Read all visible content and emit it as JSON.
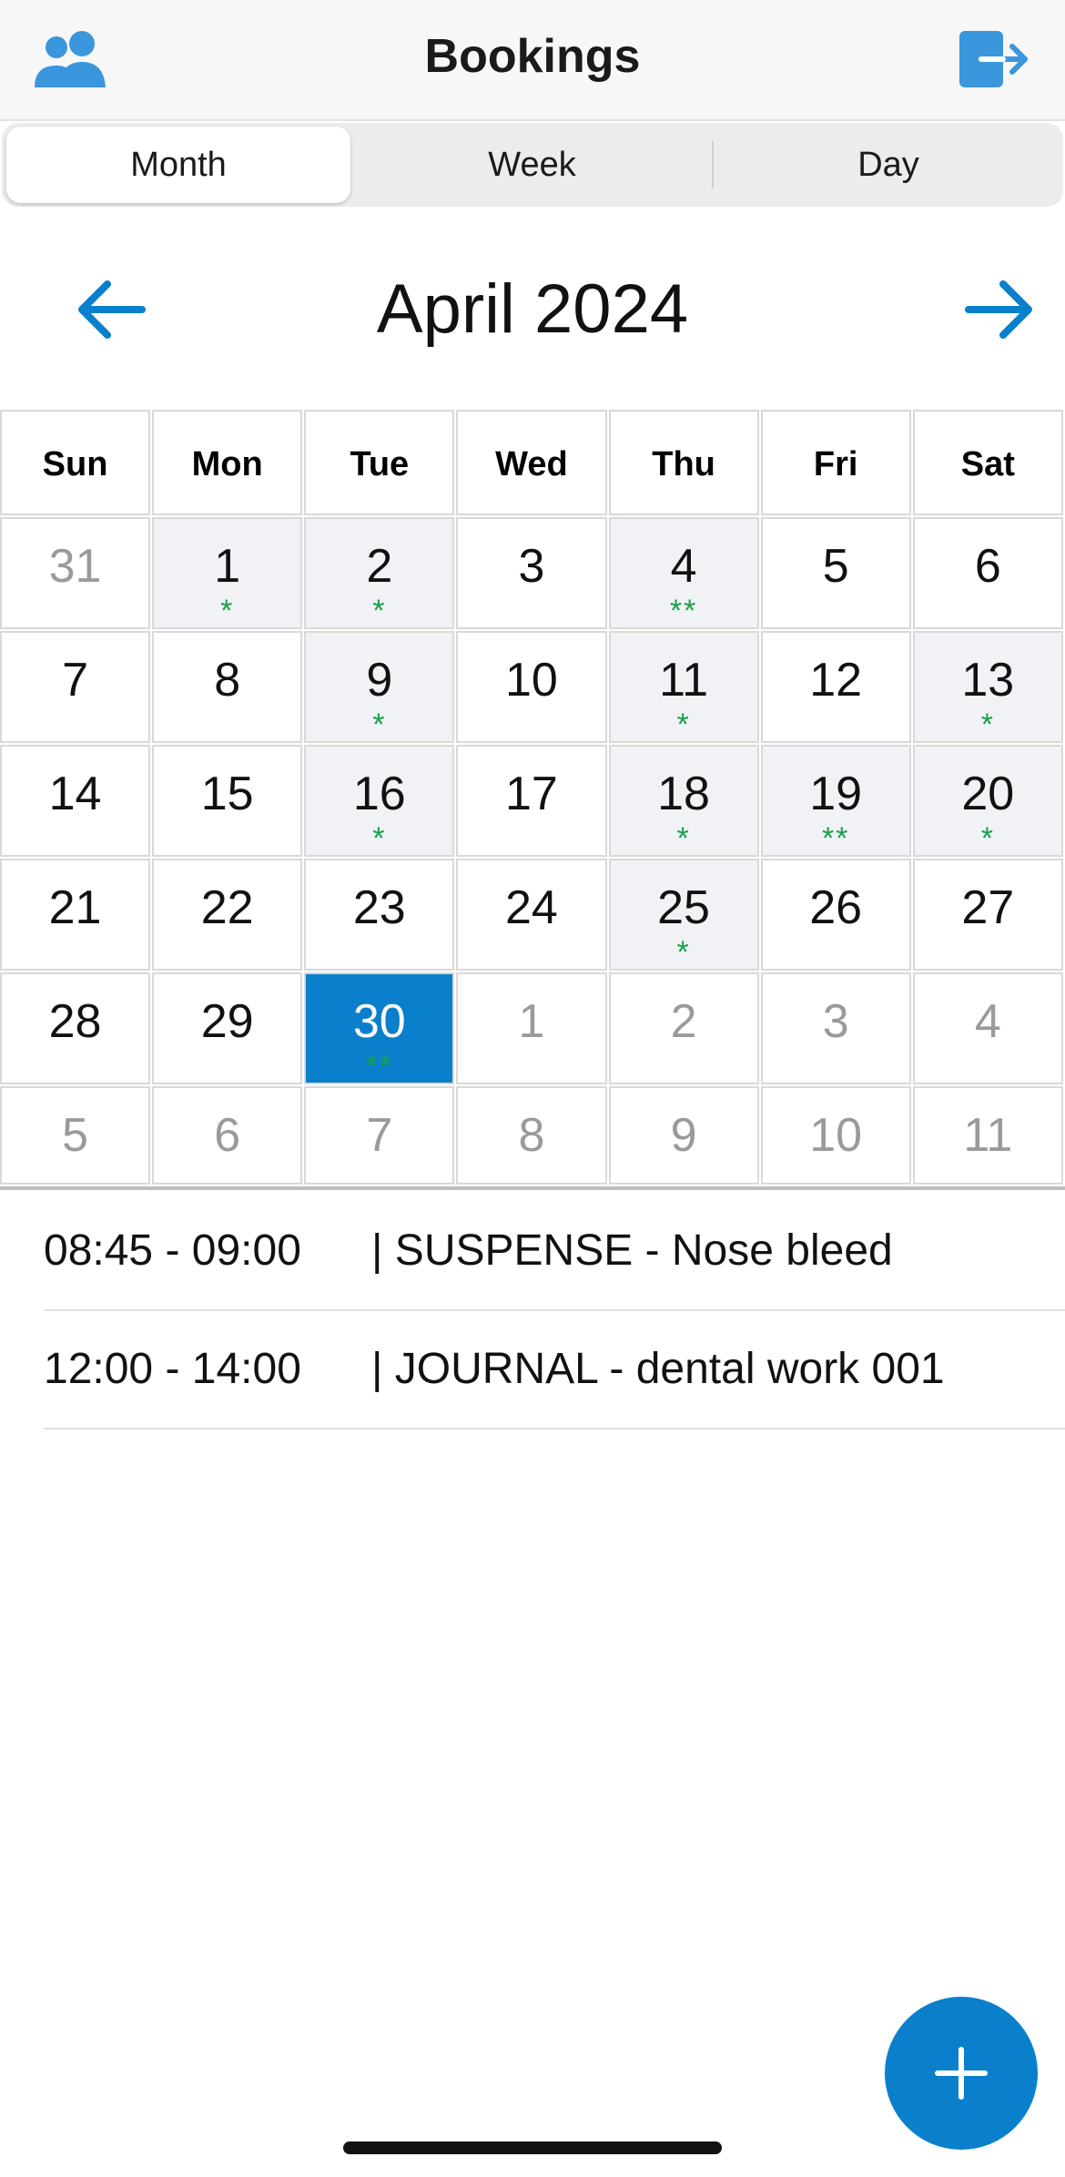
{
  "header": {
    "title": "Bookings",
    "left_icon": "users-icon",
    "right_icon": "logout-icon",
    "accent_color": "#3a96dd"
  },
  "view_tabs": [
    {
      "label": "Month",
      "selected": true
    },
    {
      "label": "Week",
      "selected": false
    },
    {
      "label": "Day",
      "selected": false
    }
  ],
  "calendar": {
    "month_title": "April 2024",
    "prev_icon": "arrow-left-icon",
    "next_icon": "arrow-right-icon",
    "weekdays": [
      "Sun",
      "Mon",
      "Tue",
      "Wed",
      "Thu",
      "Fri",
      "Sat"
    ],
    "weeks": [
      [
        {
          "day": "31",
          "current_month": false,
          "markers": ""
        },
        {
          "day": "1",
          "current_month": true,
          "markers": "*"
        },
        {
          "day": "2",
          "current_month": true,
          "markers": "*"
        },
        {
          "day": "3",
          "current_month": true,
          "markers": ""
        },
        {
          "day": "4",
          "current_month": true,
          "markers": "**"
        },
        {
          "day": "5",
          "current_month": true,
          "markers": ""
        },
        {
          "day": "6",
          "current_month": true,
          "markers": ""
        }
      ],
      [
        {
          "day": "7",
          "current_month": true,
          "markers": ""
        },
        {
          "day": "8",
          "current_month": true,
          "markers": ""
        },
        {
          "day": "9",
          "current_month": true,
          "markers": "*"
        },
        {
          "day": "10",
          "current_month": true,
          "markers": ""
        },
        {
          "day": "11",
          "current_month": true,
          "markers": "*"
        },
        {
          "day": "12",
          "current_month": true,
          "markers": ""
        },
        {
          "day": "13",
          "current_month": true,
          "markers": "*"
        }
      ],
      [
        {
          "day": "14",
          "current_month": true,
          "markers": ""
        },
        {
          "day": "15",
          "current_month": true,
          "markers": ""
        },
        {
          "day": "16",
          "current_month": true,
          "markers": "*"
        },
        {
          "day": "17",
          "current_month": true,
          "markers": ""
        },
        {
          "day": "18",
          "current_month": true,
          "markers": "*"
        },
        {
          "day": "19",
          "current_month": true,
          "markers": "**"
        },
        {
          "day": "20",
          "current_month": true,
          "markers": "*"
        }
      ],
      [
        {
          "day": "21",
          "current_month": true,
          "markers": ""
        },
        {
          "day": "22",
          "current_month": true,
          "markers": ""
        },
        {
          "day": "23",
          "current_month": true,
          "markers": ""
        },
        {
          "day": "24",
          "current_month": true,
          "markers": ""
        },
        {
          "day": "25",
          "current_month": true,
          "markers": "*"
        },
        {
          "day": "26",
          "current_month": true,
          "markers": ""
        },
        {
          "day": "27",
          "current_month": true,
          "markers": ""
        }
      ],
      [
        {
          "day": "28",
          "current_month": true,
          "markers": ""
        },
        {
          "day": "29",
          "current_month": true,
          "markers": ""
        },
        {
          "day": "30",
          "current_month": true,
          "markers": "**",
          "selected": true
        },
        {
          "day": "1",
          "current_month": false,
          "markers": ""
        },
        {
          "day": "2",
          "current_month": false,
          "markers": ""
        },
        {
          "day": "3",
          "current_month": false,
          "markers": ""
        },
        {
          "day": "4",
          "current_month": false,
          "markers": ""
        }
      ],
      [
        {
          "day": "5",
          "current_month": false,
          "markers": ""
        },
        {
          "day": "6",
          "current_month": false,
          "markers": ""
        },
        {
          "day": "7",
          "current_month": false,
          "markers": ""
        },
        {
          "day": "8",
          "current_month": false,
          "markers": ""
        },
        {
          "day": "9",
          "current_month": false,
          "markers": ""
        },
        {
          "day": "10",
          "current_month": false,
          "markers": ""
        },
        {
          "day": "11",
          "current_month": false,
          "markers": ""
        }
      ]
    ],
    "event_marker_color": "#1aa04c",
    "selected_color": "#0a80cc"
  },
  "events": [
    {
      "time": "08:45 - 09:00",
      "text": "| SUSPENSE - Nose bleed"
    },
    {
      "time": "12:00 - 14:00",
      "text": "| JOURNAL - dental work 001"
    }
  ],
  "fab": {
    "icon": "plus-icon"
  }
}
